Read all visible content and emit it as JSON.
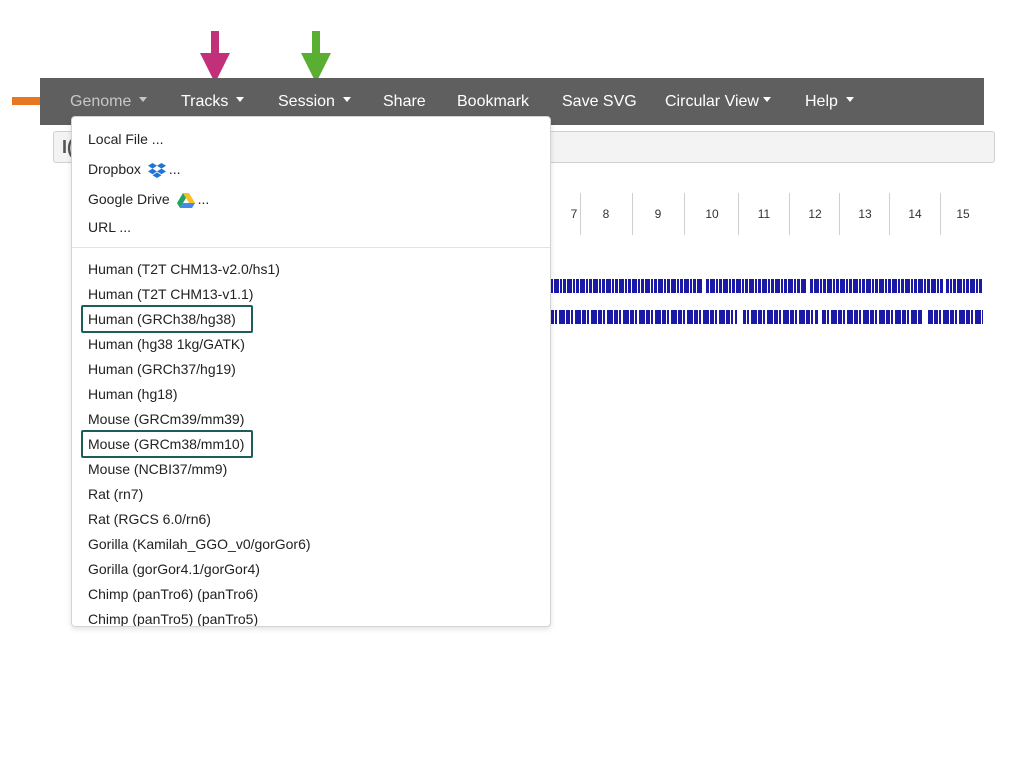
{
  "navbar": {
    "items": [
      {
        "label": "Genome",
        "caret": true,
        "active": true
      },
      {
        "label": "Tracks",
        "caret": true
      },
      {
        "label": "Session",
        "caret": true
      },
      {
        "label": "Share",
        "caret": false
      },
      {
        "label": "Bookmark",
        "caret": false
      },
      {
        "label": "Save SVG",
        "caret": false
      },
      {
        "label": "Circular View",
        "caret": true
      },
      {
        "label": "Help",
        "caret": true
      }
    ]
  },
  "locus": {
    "visible_text": "I("
  },
  "chromosomes": [
    "7",
    "8",
    "9",
    "10",
    "11",
    "12",
    "13",
    "14",
    "15"
  ],
  "genome_menu": {
    "load_options": [
      "Local File ...",
      "Dropbox",
      "Google Drive",
      "URL ..."
    ],
    "ellipsis": "...",
    "genomes": [
      "Human (T2T CHM13-v2.0/hs1)",
      "Human (T2T CHM13-v1.1)",
      "Human (GRCh38/hg38)",
      "Human (hg38 1kg/GATK)",
      "Human (GRCh37/hg19)",
      "Human (hg18)",
      "Mouse (GRCm39/mm39)",
      "Mouse (GRCm38/mm10)",
      "Mouse (NCBI37/mm9)",
      "Rat (rn7)",
      "Rat (RGCS 6.0/rn6)",
      "Gorilla (Kamilah_GGO_v0/gorGor6)",
      "Gorilla (gorGor4.1/gorGor4)",
      "Chimp (panTro6) (panTro6)",
      "Chimp (panTro5) (panTro5)"
    ],
    "highlighted": [
      "Human (GRCh38/hg38)",
      "Mouse (GRCm38/mm10)"
    ]
  },
  "annotation_colors": {
    "genome_arrow": "#e87722",
    "tracks_arrow": "#c2307a",
    "session_arrow": "#5aae32",
    "highlight_box": "#1f5d5a",
    "track_color": "#1a1aa6"
  },
  "icons": [
    "caret-down-icon",
    "dropbox-icon",
    "google-drive-icon",
    "arrow-icon"
  ]
}
